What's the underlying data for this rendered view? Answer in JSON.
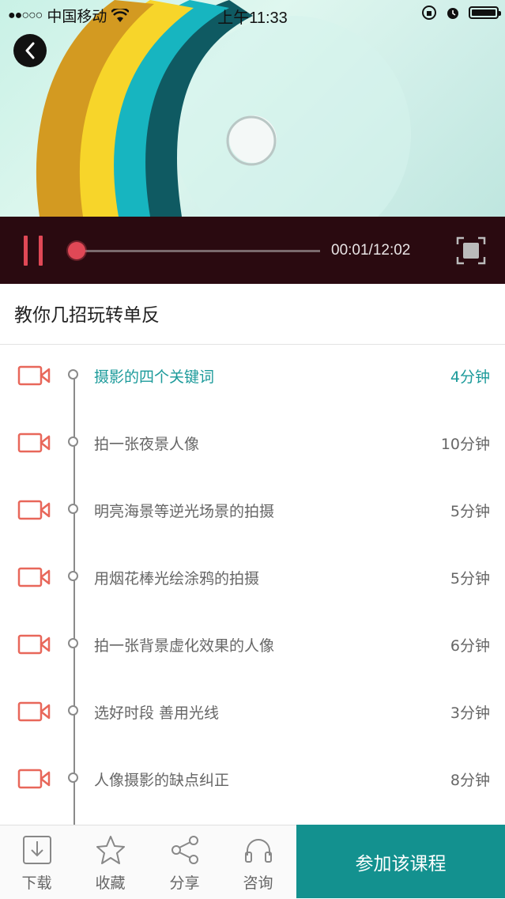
{
  "status_bar": {
    "carrier": "中国移动",
    "time": "上午11:33"
  },
  "player": {
    "progress_fraction": 0.0014,
    "time_display": "00:01/12:02"
  },
  "course": {
    "title": "教你几招玩转单反"
  },
  "lessons": [
    {
      "title": "摄影的四个关键词",
      "duration": "4分钟",
      "active": true
    },
    {
      "title": "拍一张夜景人像",
      "duration": "10分钟",
      "active": false
    },
    {
      "title": "明亮海景等逆光场景的拍摄",
      "duration": "5分钟",
      "active": false
    },
    {
      "title": "用烟花棒光绘涂鸦的拍摄",
      "duration": "5分钟",
      "active": false
    },
    {
      "title": "拍一张背景虚化效果的人像",
      "duration": "6分钟",
      "active": false
    },
    {
      "title": "选好时段 善用光线",
      "duration": "3分钟",
      "active": false
    },
    {
      "title": "人像摄影的缺点纠正",
      "duration": "8分钟",
      "active": false
    }
  ],
  "bottom_bar": {
    "download": "下载",
    "favorite": "收藏",
    "share": "分享",
    "consult": "咨询",
    "join": "参加该课程"
  },
  "colors": {
    "accent": "#13918f",
    "player_bg": "#2a0a10",
    "player_red": "#e04856",
    "camera_icon": "#e8675a"
  }
}
